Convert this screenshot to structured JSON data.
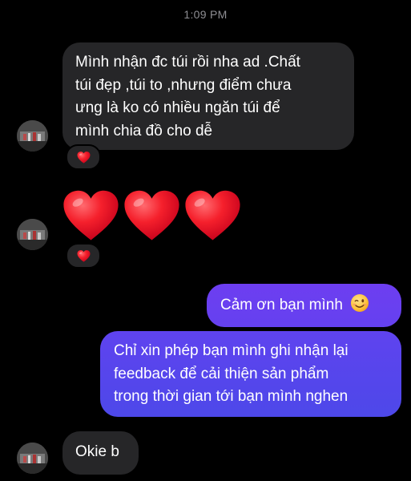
{
  "timestamp": "1:09 PM",
  "colors": {
    "background": "#000000",
    "incoming_bubble": "#262628",
    "outgoing_gradient_top": "#6e3ff1",
    "outgoing_gradient_bottom": "#4f46e8",
    "heart": "#ff2d38"
  },
  "messages": [
    {
      "direction": "incoming",
      "lines": [
        "Mình nhận đc túi rồi nha ad .Chất",
        "túi đẹp ,túi to ,nhưng điểm chưa",
        "ưng là ko có nhiều ngăn túi để",
        "mình chia đồ cho dễ"
      ],
      "reaction": "heart-icon"
    },
    {
      "direction": "incoming",
      "emoji": [
        "heart-icon",
        "heart-icon",
        "heart-icon"
      ],
      "reaction": "heart-icon"
    },
    {
      "direction": "outgoing",
      "text": "Cảm ơn bạn mình",
      "trailing_emoji": "winking-face-icon"
    },
    {
      "direction": "outgoing",
      "lines": [
        "Chỉ xin phép bạn mình ghi nhận lại",
        "feedback để cải thiện sản phẩm",
        "trong thời gian tới bạn mình nghen"
      ]
    },
    {
      "direction": "incoming",
      "text": "Okie b"
    }
  ]
}
